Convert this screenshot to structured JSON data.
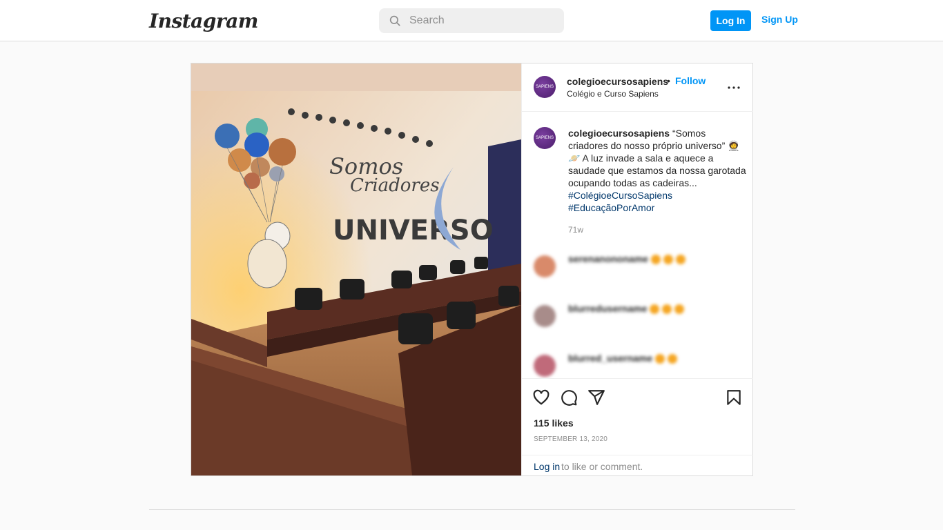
{
  "nav": {
    "logo_text": "Instagram",
    "search_placeholder": "Search",
    "login_label": "Log In",
    "signup_label": "Sign Up"
  },
  "post": {
    "username": "colegioecursosapiens",
    "follow_label": "Follow",
    "separator": "•",
    "subtitle": "Colégio e Curso Sapiens",
    "avatar_text": "SAPIENS",
    "caption": {
      "username": "colegioecursosapiens",
      "text": "“Somos criadores do nosso próprio universo” 🧑‍🚀🪐 A luz invade a sala e aquece a saudade que estamos da nossa garotada ocupando todas as cadeiras...",
      "hashtags": [
        "#ColégioeCursoSapiens",
        "#EducaçãoPorAmor"
      ],
      "time": "71w"
    },
    "comments": [
      {
        "username": "serenanononame"
      },
      {
        "username": "blurredusername"
      },
      {
        "username": "blurred_username"
      }
    ],
    "likes": "115 likes",
    "date": "SEPTEMBER 13, 2020",
    "login_link": "Log in",
    "login_rest": "to like or comment."
  },
  "colors": {
    "accent": "#0095f6",
    "hashtag": "#00376b",
    "border": "#dbdbdb",
    "muted": "#8e8e8e"
  },
  "icons": [
    "search-icon",
    "more-icon",
    "heart-icon",
    "comment-icon",
    "share-icon",
    "bookmark-icon"
  ]
}
